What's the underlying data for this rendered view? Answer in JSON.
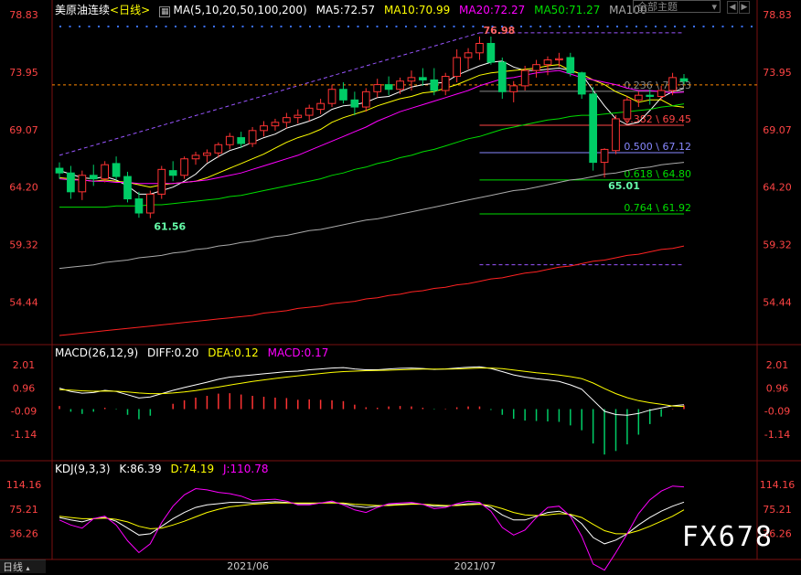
{
  "header": {
    "instrument": "美原油连续",
    "period": "<日线>",
    "ma_label": "MA(5,10,20,50,100,200)",
    "ma5": "MA5:72.57",
    "ma10": "MA10:70.99",
    "ma20": "MA20:72.27",
    "ma50": "MA50:71.27",
    "ma100": "MA100",
    "theme_selector": "全部主题",
    "theme_arrow": "▾"
  },
  "macd_panel": {
    "label": "MACD(26,12,9)",
    "diff": "DIFF:0.20",
    "dea": "DEA:0.12",
    "macd": "MACD:0.17"
  },
  "kdj_panel": {
    "label": "KDJ(9,3,3)",
    "k": "K:86.39",
    "d": "D:74.19",
    "j": "J:110.78"
  },
  "footer": {
    "period_tab": "日线"
  },
  "watermark": "FX678",
  "colors": {
    "up": "#ff3333",
    "down": "#00cc66",
    "ma5": "#ffffff",
    "ma10": "#ffff00",
    "ma20": "#ff00ff",
    "ma50": "#00dd00",
    "ma100": "#aaaaaa",
    "ma200": "#ff2222",
    "axis_text": "#ff4444"
  },
  "chart_data": {
    "type": "candlestick",
    "price_axis_ticks": [
      78.83,
      73.95,
      69.07,
      64.2,
      59.32,
      54.44
    ],
    "macd_axis_ticks": [
      2.01,
      0.96,
      -0.09,
      -1.14
    ],
    "kdj_axis_ticks": [
      114.16,
      75.21,
      36.26
    ],
    "x_tick_labels": [
      "2021/06",
      "2021/07"
    ],
    "ylim": [
      50.9,
      79.0
    ],
    "candles": [
      {
        "o": 65.8,
        "h": 66.3,
        "l": 64.9,
        "c": 65.4
      },
      {
        "o": 65.4,
        "h": 66.0,
        "l": 63.2,
        "c": 63.8
      },
      {
        "o": 63.8,
        "h": 65.6,
        "l": 63.1,
        "c": 65.2
      },
      {
        "o": 65.2,
        "h": 66.1,
        "l": 64.3,
        "c": 64.9
      },
      {
        "o": 64.9,
        "h": 66.4,
        "l": 64.6,
        "c": 66.1
      },
      {
        "o": 66.2,
        "h": 66.8,
        "l": 64.8,
        "c": 65.1
      },
      {
        "o": 65.1,
        "h": 65.5,
        "l": 62.9,
        "c": 63.2
      },
      {
        "o": 63.2,
        "h": 63.8,
        "l": 61.6,
        "c": 62.0
      },
      {
        "o": 62.0,
        "h": 63.9,
        "l": 61.56,
        "c": 63.6
      },
      {
        "o": 63.6,
        "h": 66.0,
        "l": 63.2,
        "c": 65.7
      },
      {
        "o": 65.6,
        "h": 66.4,
        "l": 64.7,
        "c": 65.2
      },
      {
        "o": 65.2,
        "h": 66.8,
        "l": 64.9,
        "c": 66.6
      },
      {
        "o": 66.6,
        "h": 67.2,
        "l": 66.1,
        "c": 66.9
      },
      {
        "o": 66.9,
        "h": 67.4,
        "l": 66.3,
        "c": 67.1
      },
      {
        "o": 67.1,
        "h": 68.0,
        "l": 66.7,
        "c": 67.8
      },
      {
        "o": 67.8,
        "h": 68.8,
        "l": 67.4,
        "c": 68.5
      },
      {
        "o": 68.4,
        "h": 68.9,
        "l": 67.5,
        "c": 67.9
      },
      {
        "o": 67.9,
        "h": 69.3,
        "l": 67.6,
        "c": 69.0
      },
      {
        "o": 69.0,
        "h": 69.8,
        "l": 68.5,
        "c": 69.4
      },
      {
        "o": 69.4,
        "h": 70.0,
        "l": 69.0,
        "c": 69.7
      },
      {
        "o": 69.7,
        "h": 70.5,
        "l": 69.2,
        "c": 70.1
      },
      {
        "o": 70.1,
        "h": 70.8,
        "l": 69.6,
        "c": 70.3
      },
      {
        "o": 70.3,
        "h": 71.2,
        "l": 69.8,
        "c": 70.9
      },
      {
        "o": 70.8,
        "h": 71.7,
        "l": 70.4,
        "c": 71.3
      },
      {
        "o": 71.3,
        "h": 72.9,
        "l": 71.0,
        "c": 72.5
      },
      {
        "o": 72.5,
        "h": 73.1,
        "l": 71.3,
        "c": 71.6
      },
      {
        "o": 71.6,
        "h": 72.3,
        "l": 70.3,
        "c": 71.0
      },
      {
        "o": 71.0,
        "h": 72.6,
        "l": 70.6,
        "c": 72.3
      },
      {
        "o": 72.3,
        "h": 73.4,
        "l": 71.8,
        "c": 72.9
      },
      {
        "o": 72.9,
        "h": 73.6,
        "l": 72.0,
        "c": 72.5
      },
      {
        "o": 72.5,
        "h": 73.5,
        "l": 72.1,
        "c": 73.2
      },
      {
        "o": 73.2,
        "h": 74.1,
        "l": 72.4,
        "c": 73.5
      },
      {
        "o": 73.5,
        "h": 74.3,
        "l": 72.8,
        "c": 73.3
      },
      {
        "o": 73.3,
        "h": 74.3,
        "l": 72.0,
        "c": 72.4
      },
      {
        "o": 72.4,
        "h": 73.9,
        "l": 72.0,
        "c": 73.6
      },
      {
        "o": 73.6,
        "h": 75.9,
        "l": 73.1,
        "c": 75.2
      },
      {
        "o": 75.2,
        "h": 76.0,
        "l": 74.2,
        "c": 75.6
      },
      {
        "o": 75.6,
        "h": 76.98,
        "l": 75.0,
        "c": 76.4
      },
      {
        "o": 76.4,
        "h": 76.98,
        "l": 74.6,
        "c": 74.8
      },
      {
        "o": 74.8,
        "h": 75.2,
        "l": 71.7,
        "c": 72.3
      },
      {
        "o": 72.3,
        "h": 73.2,
        "l": 71.4,
        "c": 72.8
      },
      {
        "o": 72.8,
        "h": 74.5,
        "l": 72.4,
        "c": 74.1
      },
      {
        "o": 74.1,
        "h": 75.0,
        "l": 73.5,
        "c": 74.6
      },
      {
        "o": 74.6,
        "h": 75.3,
        "l": 73.7,
        "c": 75.0
      },
      {
        "o": 75.0,
        "h": 75.6,
        "l": 74.4,
        "c": 75.1
      },
      {
        "o": 75.2,
        "h": 75.6,
        "l": 73.6,
        "c": 73.9
      },
      {
        "o": 73.9,
        "h": 74.0,
        "l": 71.7,
        "c": 72.1
      },
      {
        "o": 72.1,
        "h": 72.7,
        "l": 65.6,
        "c": 66.3
      },
      {
        "o": 66.3,
        "h": 67.5,
        "l": 65.01,
        "c": 67.4
      },
      {
        "o": 67.3,
        "h": 70.3,
        "l": 67.0,
        "c": 70.0
      },
      {
        "o": 70.0,
        "h": 71.9,
        "l": 69.5,
        "c": 71.6
      },
      {
        "o": 71.6,
        "h": 72.3,
        "l": 71.0,
        "c": 72.0
      },
      {
        "o": 72.0,
        "h": 72.5,
        "l": 71.2,
        "c": 71.9
      },
      {
        "o": 71.9,
        "h": 72.8,
        "l": 71.6,
        "c": 72.4
      },
      {
        "o": 72.4,
        "h": 73.9,
        "l": 72.0,
        "c": 73.5
      },
      {
        "o": 73.4,
        "h": 73.8,
        "l": 72.9,
        "c": 73.2
      }
    ],
    "ma_lines": {
      "ma5": [
        65.6,
        65.3,
        65.0,
        64.9,
        65.1,
        64.8,
        64.3,
        63.6,
        63.6,
        63.9,
        64.2,
        64.7,
        65.3,
        66.2,
        66.8,
        67.3,
        67.6,
        68.0,
        68.4,
        68.7,
        69.2,
        69.5,
        69.8,
        70.2,
        70.8,
        71.1,
        71.2,
        71.4,
        71.8,
        71.9,
        72.3,
        72.7,
        72.9,
        73.0,
        73.1,
        73.7,
        74.1,
        74.5,
        74.8,
        74.9,
        74.4,
        74.1,
        74.1,
        74.2,
        74.3,
        74.1,
        73.8,
        72.4,
        71.1,
        70.0,
        69.5,
        69.7,
        70.7,
        71.8,
        72.3,
        72.57
      ],
      "ma10": [
        65.0,
        64.9,
        64.8,
        64.7,
        64.8,
        64.7,
        64.6,
        64.4,
        64.2,
        64.4,
        64.5,
        64.6,
        64.7,
        65.0,
        65.4,
        65.8,
        66.2,
        66.6,
        67.0,
        67.5,
        68.0,
        68.4,
        68.7,
        69.1,
        69.7,
        70.1,
        70.4,
        70.7,
        71.1,
        71.4,
        71.7,
        71.9,
        72.2,
        72.3,
        72.6,
        72.9,
        73.3,
        73.7,
        73.9,
        74.0,
        74.1,
        74.2,
        74.3,
        74.5,
        74.6,
        74.1,
        73.8,
        73.3,
        72.9,
        72.3,
        71.9,
        71.4,
        71.6,
        71.6,
        71.1,
        70.99
      ],
      "ma20": [
        64.9,
        64.8,
        64.8,
        64.7,
        64.7,
        64.6,
        64.6,
        64.5,
        64.5,
        64.5,
        64.5,
        64.6,
        64.7,
        64.8,
        65.0,
        65.2,
        65.4,
        65.7,
        66.0,
        66.3,
        66.6,
        66.9,
        67.3,
        67.7,
        68.1,
        68.5,
        68.9,
        69.3,
        69.8,
        70.2,
        70.6,
        70.9,
        71.2,
        71.5,
        71.8,
        72.1,
        72.4,
        72.8,
        73.1,
        73.4,
        73.5,
        73.7,
        73.9,
        74.0,
        74.1,
        73.8,
        73.5,
        73.3,
        73.1,
        72.9,
        72.6,
        72.4,
        72.4,
        72.3,
        72.2,
        72.27
      ],
      "ma50": [
        62.5,
        62.5,
        62.5,
        62.5,
        62.5,
        62.6,
        62.6,
        62.6,
        62.7,
        62.7,
        62.8,
        62.9,
        63.0,
        63.1,
        63.2,
        63.4,
        63.5,
        63.7,
        63.9,
        64.1,
        64.3,
        64.5,
        64.7,
        64.9,
        65.2,
        65.4,
        65.7,
        65.9,
        66.2,
        66.4,
        66.7,
        66.9,
        67.2,
        67.4,
        67.7,
        68.0,
        68.3,
        68.5,
        68.8,
        69.1,
        69.3,
        69.5,
        69.7,
        69.9,
        70.0,
        70.2,
        70.3,
        70.3,
        70.4,
        70.5,
        70.6,
        70.7,
        70.8,
        71.0,
        71.1,
        71.27
      ],
      "ma100": [
        57.3,
        57.4,
        57.5,
        57.6,
        57.8,
        57.9,
        58.0,
        58.2,
        58.3,
        58.4,
        58.6,
        58.7,
        58.9,
        59.0,
        59.2,
        59.3,
        59.5,
        59.6,
        59.8,
        60.0,
        60.1,
        60.3,
        60.5,
        60.6,
        60.8,
        61.0,
        61.2,
        61.4,
        61.5,
        61.7,
        61.9,
        62.1,
        62.3,
        62.5,
        62.7,
        62.9,
        63.1,
        63.3,
        63.5,
        63.7,
        63.9,
        64.0,
        64.2,
        64.4,
        64.6,
        64.8,
        64.9,
        65.1,
        65.3,
        65.4,
        65.6,
        65.8,
        65.9,
        66.1,
        66.2,
        66.3
      ],
      "ma200": [
        51.6,
        51.7,
        51.8,
        51.9,
        52.0,
        52.1,
        52.2,
        52.3,
        52.4,
        52.5,
        52.6,
        52.7,
        52.8,
        52.9,
        53.0,
        53.1,
        53.2,
        53.3,
        53.5,
        53.6,
        53.7,
        53.9,
        54.0,
        54.1,
        54.3,
        54.4,
        54.5,
        54.7,
        54.8,
        55.0,
        55.1,
        55.3,
        55.4,
        55.6,
        55.7,
        55.9,
        56.0,
        56.2,
        56.4,
        56.5,
        56.7,
        56.9,
        57.0,
        57.2,
        57.4,
        57.5,
        57.7,
        57.9,
        58.0,
        58.2,
        58.4,
        58.5,
        58.7,
        58.9,
        59.0,
        59.2
      ]
    },
    "annotations": [
      {
        "text": "76.98",
        "price": 76.98,
        "candle": 37
      },
      {
        "text": "61.56",
        "price": 61.56,
        "candle": 8
      },
      {
        "text": "65.01",
        "price": 65.01,
        "candle": 48
      }
    ],
    "fibonacci": [
      {
        "label": "0.236 \\ 72.33",
        "price": 72.33,
        "color": "#888888"
      },
      {
        "label": "0.382 \\ 69.45",
        "price": 69.45,
        "color": "#ff4444"
      },
      {
        "label": "0.500 \\ 67.12",
        "price": 67.12,
        "color": "#8888ff"
      },
      {
        "label": "0.618 \\ 64.80",
        "price": 64.8,
        "color": "#00dd00"
      },
      {
        "label": "0.764 \\ 61.92",
        "price": 61.92,
        "color": "#00dd00"
      }
    ],
    "current_price": 72.88,
    "channel": {
      "upper": [
        66.9,
        77.3
      ],
      "lower": [
        57.6
      ]
    },
    "macd": {
      "ylim": [
        -2.3,
        2.3
      ],
      "diff": [
        0.95,
        0.8,
        0.72,
        0.75,
        0.85,
        0.8,
        0.65,
        0.5,
        0.55,
        0.7,
        0.85,
        0.98,
        1.1,
        1.22,
        1.35,
        1.45,
        1.5,
        1.55,
        1.6,
        1.65,
        1.7,
        1.72,
        1.78,
        1.82,
        1.86,
        1.88,
        1.82,
        1.78,
        1.78,
        1.82,
        1.85,
        1.86,
        1.84,
        1.8,
        1.82,
        1.86,
        1.9,
        1.92,
        1.84,
        1.7,
        1.55,
        1.45,
        1.38,
        1.32,
        1.25,
        1.1,
        0.9,
        0.4,
        -0.1,
        -0.25,
        -0.28,
        -0.2,
        -0.05,
        0.05,
        0.15,
        0.2
      ],
      "dea": [
        0.88,
        0.86,
        0.83,
        0.81,
        0.82,
        0.81,
        0.78,
        0.73,
        0.7,
        0.7,
        0.73,
        0.78,
        0.84,
        0.92,
        1.0,
        1.09,
        1.17,
        1.25,
        1.32,
        1.39,
        1.45,
        1.51,
        1.56,
        1.61,
        1.66,
        1.7,
        1.72,
        1.74,
        1.75,
        1.76,
        1.78,
        1.8,
        1.81,
        1.81,
        1.81,
        1.82,
        1.84,
        1.86,
        1.86,
        1.83,
        1.77,
        1.71,
        1.65,
        1.6,
        1.54,
        1.47,
        1.38,
        1.18,
        0.93,
        0.7,
        0.52,
        0.38,
        0.29,
        0.22,
        0.14,
        0.12
      ],
      "macd": [
        0.14,
        -0.12,
        -0.22,
        -0.12,
        0.06,
        -0.02,
        -0.26,
        -0.46,
        -0.3,
        0.0,
        0.24,
        0.4,
        0.52,
        0.6,
        0.7,
        0.72,
        0.66,
        0.6,
        0.56,
        0.52,
        0.5,
        0.42,
        0.44,
        0.42,
        0.4,
        0.36,
        0.2,
        0.08,
        0.06,
        0.12,
        0.14,
        0.12,
        0.06,
        -0.02,
        0.02,
        0.08,
        0.12,
        0.12,
        -0.04,
        -0.26,
        -0.44,
        -0.52,
        -0.54,
        -0.56,
        -0.58,
        -0.74,
        -0.96,
        -1.56,
        -2.06,
        -1.9,
        -1.6,
        -1.16,
        -0.68,
        -0.34,
        0.02,
        0.17
      ]
    },
    "kdj": {
      "ylim": [
        -2,
        132
      ],
      "k": [
        62,
        58,
        55,
        60,
        62,
        56,
        45,
        34,
        36,
        48,
        60,
        70,
        78,
        82,
        84,
        86,
        86,
        85,
        86,
        87,
        86,
        84,
        84,
        85,
        86,
        84,
        80,
        78,
        80,
        82,
        83,
        84,
        83,
        80,
        80,
        82,
        84,
        84,
        78,
        66,
        58,
        58,
        64,
        70,
        72,
        66,
        52,
        30,
        20,
        26,
        36,
        50,
        62,
        72,
        80,
        86.39
      ],
      "d": [
        64,
        62,
        60,
        60,
        61,
        59,
        55,
        48,
        44,
        45,
        50,
        56,
        63,
        70,
        75,
        79,
        81,
        83,
        84,
        85,
        85,
        85,
        85,
        85,
        85,
        85,
        83,
        82,
        81,
        81,
        82,
        83,
        83,
        82,
        81,
        81,
        82,
        83,
        81,
        76,
        70,
        66,
        65,
        66,
        68,
        67,
        62,
        51,
        41,
        36,
        36,
        41,
        48,
        56,
        64,
        74.19
      ],
      "j": [
        58,
        50,
        45,
        60,
        64,
        50,
        25,
        6,
        20,
        54,
        80,
        98,
        108,
        106,
        102,
        100,
        96,
        89,
        90,
        91,
        88,
        82,
        82,
        85,
        88,
        82,
        74,
        70,
        78,
        84,
        85,
        86,
        83,
        76,
        78,
        84,
        88,
        86,
        72,
        46,
        34,
        42,
        62,
        78,
        80,
        64,
        32,
        -12,
        -22,
        6,
        36,
        68,
        90,
        104,
        112,
        110.78
      ]
    }
  }
}
